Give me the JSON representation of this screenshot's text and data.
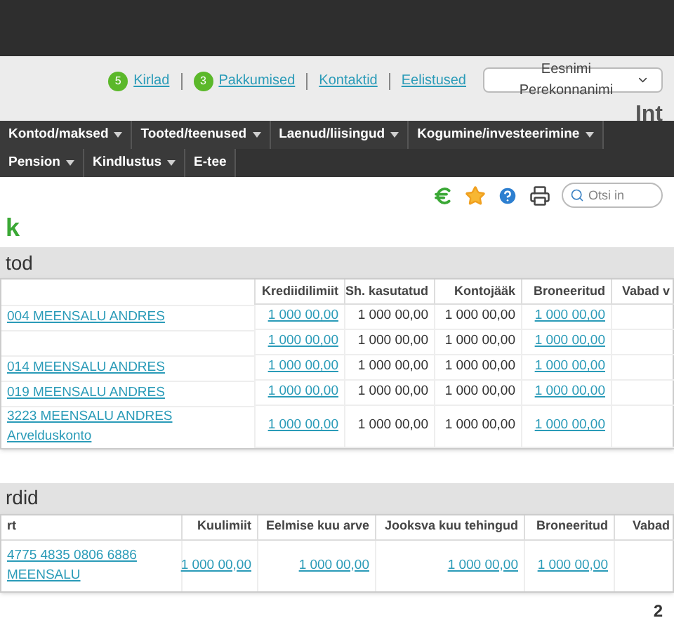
{
  "header": {
    "links": [
      {
        "label": "Kirlad",
        "badge": "5"
      },
      {
        "label": "Pakkumised",
        "badge": "3"
      },
      {
        "label": "Kontaktid"
      },
      {
        "label": "Eelistused"
      }
    ],
    "user_select": {
      "value": "Eesnimi Perekonnanimi"
    },
    "brand_text": "Int"
  },
  "nav": [
    {
      "label": "Kontod/maksed",
      "has_menu": true
    },
    {
      "label": "Tooted/teenused",
      "has_menu": true
    },
    {
      "label": "Laenud/liisingud",
      "has_menu": true
    },
    {
      "label": "Kogumine/investeerimine",
      "has_menu": true
    },
    {
      "label": "Pension",
      "has_menu": true
    },
    {
      "label": "Kindlustus",
      "has_menu": true
    },
    {
      "label": "E-tee",
      "has_menu": false
    }
  ],
  "search": {
    "placeholder": "Otsi in"
  },
  "page_title": "k",
  "accounts": {
    "title": "tod",
    "columns": [
      "Krediidilimiit",
      "Sh. kasutatud",
      "Kontojääk",
      "Broneeritud",
      "Vabad v"
    ],
    "rows": [
      {
        "account": "004 MEENSALU ANDRES",
        "limit": "1 000 00,00",
        "used": "1 000 00,00",
        "balance": "1 000 00,00",
        "reserved": "1 000 00,00"
      },
      {
        "limit": "1 000 00,00",
        "used": "1 000 00,00",
        "balance": "1 000 00,00",
        "reserved": "1 000 00,00"
      },
      {
        "account": "014 MEENSALU ANDRES",
        "limit": "1 000 00,00",
        "used": "1 000 00,00",
        "balance": "1 000 00,00",
        "reserved": "1 000 00,00"
      },
      {
        "account": "019 MEENSALU ANDRES",
        "limit": "1 000 00,00",
        "used": "1 000 00,00",
        "balance": "1 000 00,00",
        "reserved": "1 000 00,00"
      },
      {
        "account": "3223 MEENSALU ANDRES Arvelduskonto",
        "limit": "1 000 00,00",
        "used": "1 000 00,00",
        "balance": "1 000 00,00",
        "reserved": "1 000 00,00"
      }
    ]
  },
  "cards": {
    "title": "rdid",
    "columns": [
      "rt",
      "Kuulimiit",
      "Eelmise kuu arve",
      "Jooksva kuu tehingud",
      "Broneeritud",
      "Vabad"
    ],
    "rows": [
      {
        "card": "4775 4835 0806 6886 MEENSALU",
        "limit": "1 000 00,00",
        "last_bill": "1 000 00,00",
        "current": "1 000 00,00",
        "reserved": "1 000 00,00"
      }
    ],
    "total": "2"
  }
}
